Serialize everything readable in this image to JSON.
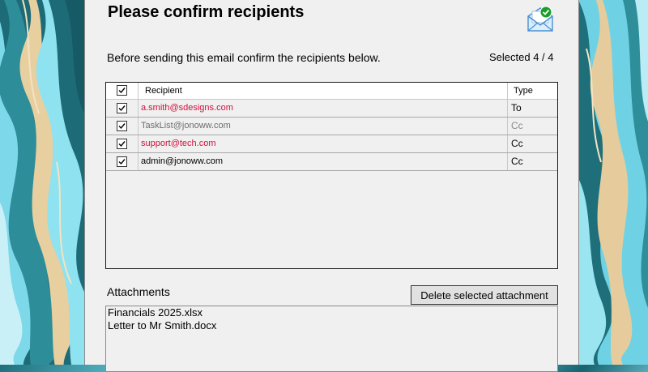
{
  "dialog": {
    "title": "Please confirm recipients",
    "instructions": "Before sending this email confirm the recipients below.",
    "selected_text": "Selected 4 / 4"
  },
  "grid": {
    "headers": {
      "recipient": "Recipient",
      "type": "Type"
    },
    "all_checked": true,
    "rows": [
      {
        "checked": true,
        "recipient": "a.smith@sdesigns.com",
        "type": "To",
        "recipient_color": "#d0103a",
        "type_color": "#000000"
      },
      {
        "checked": true,
        "recipient": "TaskList@jonoww.com",
        "type": "Cc",
        "recipient_color": "#6d6d6d",
        "type_color": "#8a8a8a"
      },
      {
        "checked": true,
        "recipient": "support@tech.com",
        "type": "Cc",
        "recipient_color": "#d0103a",
        "type_color": "#000000"
      },
      {
        "checked": true,
        "recipient": "admin@jonoww.com",
        "type": "Cc",
        "recipient_color": "#000000",
        "type_color": "#000000"
      }
    ]
  },
  "attachments": {
    "label": "Attachments",
    "delete_button": "Delete selected attachment",
    "items": [
      "Financials 2025.xlsx",
      "Letter to Mr Smith.docx"
    ]
  },
  "icons": {
    "dialog_icon": "mail-check-icon",
    "checkbox_mark": "checkmark-icon"
  },
  "colors": {
    "dialog_bg": "#f0f0f0",
    "warning_red": "#d0103a",
    "check_green": "#1a9e2a",
    "envelope_blue": "#4b8fd1"
  }
}
